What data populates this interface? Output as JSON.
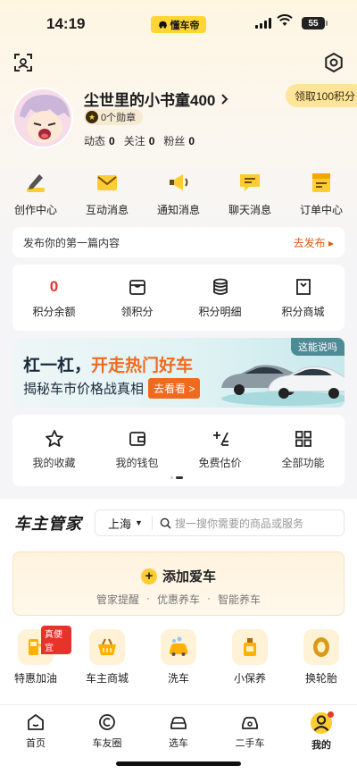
{
  "status": {
    "time": "14:19",
    "app_pill": "懂车帝",
    "battery": "55"
  },
  "profile": {
    "username": "尘世里的小书童400",
    "badge_text": "0个勋章",
    "stats": [
      {
        "label": "动态",
        "value": "0"
      },
      {
        "label": "关注",
        "value": "0"
      },
      {
        "label": "粉丝",
        "value": "0"
      }
    ],
    "claim_label": "领取100积分"
  },
  "quick_menu": [
    {
      "label": "创作中心",
      "icon": "pen-icon"
    },
    {
      "label": "互动消息",
      "icon": "envelope-icon"
    },
    {
      "label": "通知消息",
      "icon": "megaphone-icon"
    },
    {
      "label": "聊天消息",
      "icon": "chat-icon"
    },
    {
      "label": "订单中心",
      "icon": "order-icon"
    }
  ],
  "publish": {
    "prompt": "发布你的第一篇内容",
    "action": "去发布 ▸"
  },
  "points": {
    "balance": "0",
    "items": [
      {
        "label": "积分余额"
      },
      {
        "label": "领积分",
        "icon": "gift-box-icon"
      },
      {
        "label": "积分明细",
        "icon": "coin-stack-icon"
      },
      {
        "label": "积分商城",
        "icon": "shopping-bag-icon"
      }
    ]
  },
  "banner": {
    "tag": "这能说吗",
    "line1_a": "杠一杠，",
    "line1_b": "开走热门好车",
    "line2": "揭秘车市价格战真相",
    "button": "去看看 >"
  },
  "functions": [
    {
      "label": "我的收藏",
      "icon": "star-icon"
    },
    {
      "label": "我的钱包",
      "icon": "wallet-icon"
    },
    {
      "label": "免费估价",
      "icon": "calc-icon"
    },
    {
      "label": "全部功能",
      "icon": "grid-icon"
    }
  ],
  "owner_section": {
    "title": "车主管家",
    "city": "上海",
    "search_placeholder": "搜一搜你需要的商品或服务",
    "add_car": "添加爱车",
    "add_car_features": [
      "管家提醒",
      "·",
      "优惠养车",
      "·",
      "智能养车"
    ]
  },
  "services": [
    {
      "label": "特惠加油",
      "icon": "fuel-icon",
      "ribbon": "真便宜"
    },
    {
      "label": "车主商城",
      "icon": "basket-icon"
    },
    {
      "label": "洗车",
      "icon": "car-wash-icon"
    },
    {
      "label": "小保养",
      "icon": "oil-icon"
    },
    {
      "label": "换轮胎",
      "icon": "tire-icon"
    }
  ],
  "tabs": [
    {
      "label": "首页",
      "icon": "home-icon"
    },
    {
      "label": "车友圈",
      "icon": "circle-icon"
    },
    {
      "label": "选车",
      "icon": "car-icon"
    },
    {
      "label": "二手车",
      "icon": "used-car-icon"
    },
    {
      "label": "我的",
      "icon": "me-icon"
    }
  ],
  "colors": {
    "accent": "#ffcc33",
    "red": "#e8332a",
    "orange": "#f06a1e"
  }
}
